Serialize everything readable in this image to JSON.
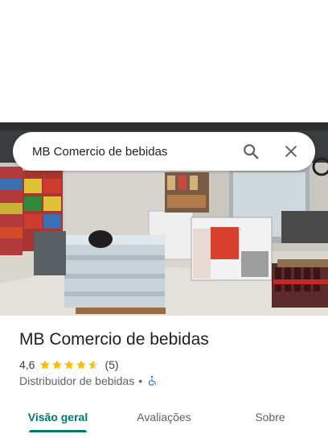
{
  "search": {
    "query": "MB Comercio de bebidas",
    "search_icon": "search-icon",
    "close_icon": "close-icon"
  },
  "place": {
    "name": "MB Comercio de bebidas",
    "rating": "4,6",
    "stars_value": 4.6,
    "stars_max": 5,
    "review_count": "(5)",
    "category": "Distribuidor de bebidas",
    "separator": "•",
    "accessibility_icon": "wheelchair-icon"
  },
  "tabs": [
    {
      "label": "Visão geral",
      "active": true
    },
    {
      "label": "Avaliações",
      "active": false
    },
    {
      "label": "Sobre",
      "active": false
    }
  ],
  "colors": {
    "accent": "#00796b",
    "star": "#fbbc04",
    "accessibility": "#1a73e8"
  }
}
